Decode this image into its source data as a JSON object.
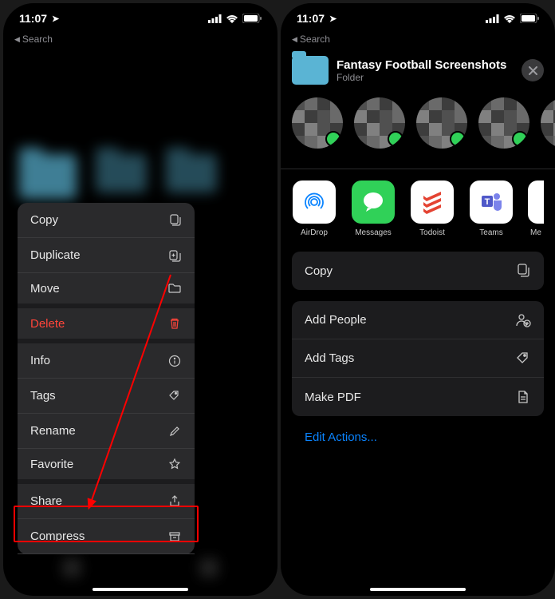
{
  "status": {
    "time": "11:07",
    "back_label": "Search"
  },
  "left": {
    "menu": [
      {
        "label": "Copy",
        "icon": "copy-icon"
      },
      {
        "label": "Duplicate",
        "icon": "duplicate-icon"
      },
      {
        "label": "Move",
        "icon": "folder-icon"
      },
      {
        "label": "Delete",
        "icon": "trash-icon",
        "danger": true
      },
      {
        "label": "Info",
        "icon": "info-icon"
      },
      {
        "label": "Tags",
        "icon": "tag-icon"
      },
      {
        "label": "Rename",
        "icon": "pencil-icon"
      },
      {
        "label": "Favorite",
        "icon": "star-icon"
      },
      {
        "label": "Share",
        "icon": "share-icon"
      },
      {
        "label": "Compress",
        "icon": "archive-icon"
      }
    ]
  },
  "right": {
    "title": "Fantasy Football Screenshots",
    "subtitle": "Folder",
    "apps": [
      {
        "label": "AirDrop"
      },
      {
        "label": "Messages"
      },
      {
        "label": "Todoist"
      },
      {
        "label": "Teams"
      },
      {
        "label": "Me"
      }
    ],
    "actions_a": [
      {
        "label": "Copy",
        "icon": "copy-icon"
      }
    ],
    "actions_b": [
      {
        "label": "Add People",
        "icon": "person-add-icon"
      },
      {
        "label": "Add Tags",
        "icon": "tag-icon"
      },
      {
        "label": "Make PDF",
        "icon": "doc-icon"
      }
    ],
    "edit_label": "Edit Actions..."
  }
}
